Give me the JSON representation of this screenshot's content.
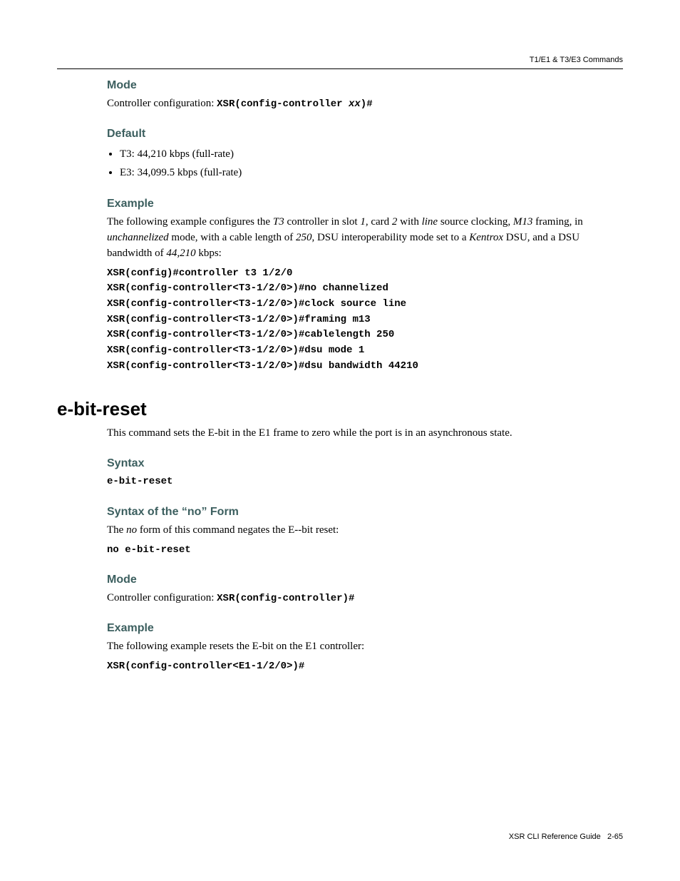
{
  "running_head": "T1/E1 & T3/E3 Commands",
  "sec_mode1": {
    "heading": "Mode",
    "text_prefix": "Controller configuration: ",
    "code_a": "XSR(config-controller ",
    "code_em": "xx",
    "code_b": ")#"
  },
  "sec_default": {
    "heading": "Default",
    "items": [
      "T3: 44,210 kbps (full-rate)",
      "E3: 34,099.5 kbps (full-rate)"
    ]
  },
  "sec_example1": {
    "heading": "Example",
    "para": {
      "p0": "The following example configures the ",
      "i0": "T3",
      "p1": " controller in slot ",
      "i1": "1",
      "p2": ", card ",
      "i2": "2",
      "p3": " with ",
      "i3": "line",
      "p4": " source clocking, ",
      "i4": "M13",
      "p5": " framing, in ",
      "i5": "unchannelized",
      "p6": " mode, with a cable length of ",
      "i6": "250",
      "p7": ", DSU interoperability mode set to a ",
      "i7": "Kentrox",
      "p8": " DSU, and a DSU bandwidth of ",
      "i8": "44,210",
      "p9": " kbps:"
    },
    "code": "XSR(config)#controller t3 1/2/0\nXSR(config-controller<T3-1/2/0>)#no channelized\nXSR(config-controller<T3-1/2/0>)#clock source line\nXSR(config-controller<T3-1/2/0>)#framing m13\nXSR(config-controller<T3-1/2/0>)#cablelength 250\nXSR(config-controller<T3-1/2/0>)#dsu mode 1\nXSR(config-controller<T3-1/2/0>)#dsu bandwidth 44210"
  },
  "cmd_title": "e-bit-reset",
  "cmd_intro": "This command sets the E-bit in the E1 frame to zero while the port is in an asynchronous state.",
  "sec_syntax": {
    "heading": "Syntax",
    "code": "e-bit-reset"
  },
  "sec_noform": {
    "heading": "Syntax of the “no” Form",
    "p0": "The ",
    "i0": "no",
    "p1": " form of this command negates the E--bit reset:",
    "code": "no e-bit-reset"
  },
  "sec_mode2": {
    "heading": "Mode",
    "text_prefix": "Controller configuration: ",
    "code": "XSR(config-controller)#"
  },
  "sec_example2": {
    "heading": "Example",
    "text": "The following example resets the E-bit on the E1 controller:",
    "code": "XSR(config-controller<E1-1/2/0>)#"
  },
  "footer": {
    "book": "XSR CLI Reference Guide",
    "page": "2-65"
  }
}
